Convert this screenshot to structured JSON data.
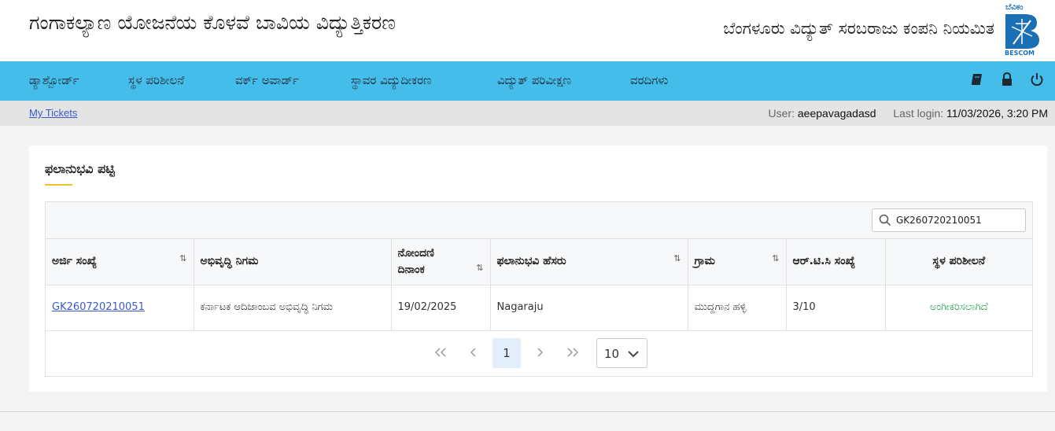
{
  "header": {
    "app_title": "ಗಂಗಾಕಲ್ಯಾಣ ಯೋಜನೆಯ ಕೊಳವೆ ಬಾವಿಯ ವಿದ್ಯುತ್ತಿಕರಣ",
    "company_name": "ಬೆಂಗಳೂರು ವಿದ್ಯುತ್ ಸರಬರಾಜು ಕಂಪನಿ ನಿಯಮಿತ",
    "logo_top_text": "ಬೆವಿಕಂ",
    "logo_bottom_text": "BESCOM",
    "brand_color": "#1b6fb5"
  },
  "nav": {
    "items": [
      {
        "label": "ಡ್ಯಾಶ್ಬೋರ್ಡ್"
      },
      {
        "label": "ಸ್ಥಳ ಪರಿಶೀಲನೆ"
      },
      {
        "label": "ವರ್ಕ್ ಅವಾರ್ಡ್"
      },
      {
        "label": "ಸ್ಥಾವರ ವಿದ್ಯುದೀಕರಣ"
      },
      {
        "label": "ವಿದ್ಯುತ್ ಪರಿವೀಕ್ಷಣ"
      },
      {
        "label": "ವರದಿಗಳು"
      }
    ],
    "icons": [
      "book-icon",
      "lock-icon",
      "power-icon"
    ],
    "background": "#45bdea"
  },
  "infobar": {
    "my_tickets": "My Tickets",
    "user_label": "User:",
    "user_value": "aeepavagadasd",
    "last_login_label": "Last login:",
    "last_login_value": "11/03/2026, 3:20 PM"
  },
  "card": {
    "title": "ಫಲಾನುಭವಿ ಪಟ್ಟಿ",
    "accent": "#f0c22b"
  },
  "search": {
    "value": "GK260720210051"
  },
  "table": {
    "columns": [
      {
        "label": "ಅರ್ಜಿ ಸಂಖ್ಯೆ",
        "sortable": true
      },
      {
        "label": "ಅಭಿವೃದ್ಧಿ ನಿಗಮ",
        "sortable": false
      },
      {
        "label": "ನೋಂದಣಿ ದಿನಾಂಕ",
        "sortable": true
      },
      {
        "label": "ಫಲಾನುಭವಿ ಹೆಸರು",
        "sortable": true
      },
      {
        "label": "ಗ್ರಾಮ",
        "sortable": true
      },
      {
        "label": "ಆರ್.ಟಿ.ಸಿ ಸಂಖ್ಯೆ",
        "sortable": false
      },
      {
        "label": "ಸ್ಥಳ ಪರಿಶೀಲನೆ",
        "sortable": false
      }
    ],
    "rows": [
      {
        "application_no": "GK260720210051",
        "corporation": "ಕರ್ನಾಟಕ ಆದಿಜಾಂಬವ ಅಭಿವೃದ್ಧಿ ನಿಗಮ",
        "registration_date": "19/02/2025",
        "beneficiary": "Nagaraju",
        "village": "ಮುದ್ದಗಾನ ಹಳ್ಳಿ",
        "rtc_no": "3/10",
        "site_inspection": "ಅಂಗೀಕರಿಸಲಾಗಿದೆ"
      }
    ],
    "status_color": "#1e9e4a"
  },
  "pagination": {
    "current_page": "1",
    "rows_per_page": "10"
  }
}
